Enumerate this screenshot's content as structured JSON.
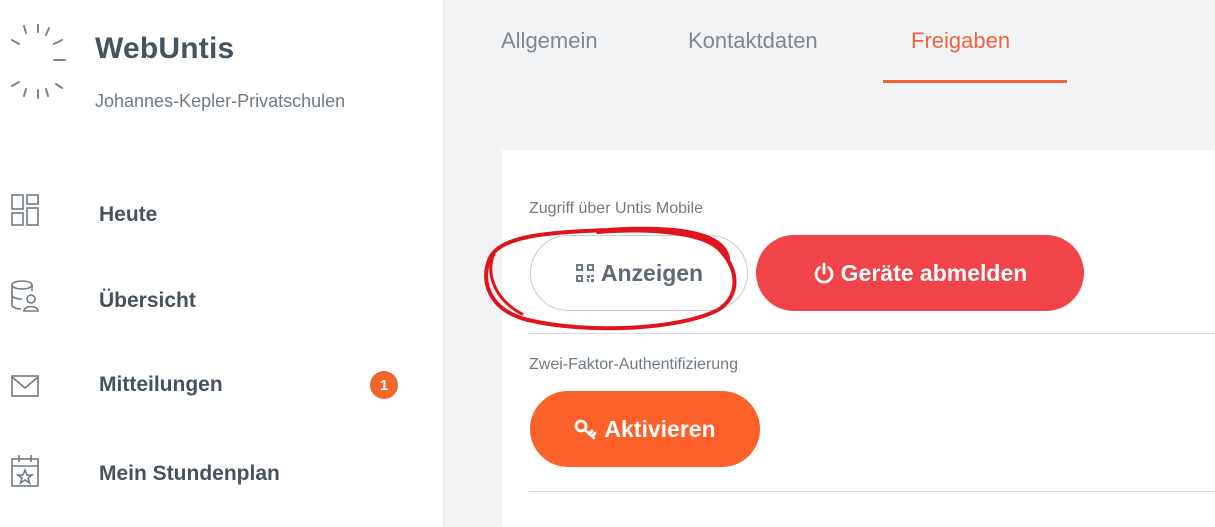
{
  "app": {
    "title": "WebUntis",
    "school": "Johannes-Kepler-Privatschulen"
  },
  "sidebar": {
    "items": [
      {
        "label": "Heute",
        "icon": "dashboard-icon"
      },
      {
        "label": "Übersicht",
        "icon": "database-user-icon"
      },
      {
        "label": "Mitteilungen",
        "icon": "mail-icon",
        "badge": "1"
      },
      {
        "label": "Mein Stundenplan",
        "icon": "calendar-star-icon"
      }
    ]
  },
  "tabs": [
    {
      "label": "Allgemein",
      "active": false
    },
    {
      "label": "Kontaktdaten",
      "active": false
    },
    {
      "label": "Freigaben",
      "active": true
    }
  ],
  "sections": {
    "mobile": {
      "label": "Zugriff über Untis Mobile",
      "show_button": "Anzeigen",
      "logout_button": "Geräte abmelden"
    },
    "twofactor": {
      "label": "Zwei-Faktor-Authentifizierung",
      "activate_button": "Aktivieren"
    }
  },
  "colors": {
    "accent": "#f0643c",
    "danger": "#f0434a",
    "primary_orange": "#fb6128",
    "badge": "#f2662e",
    "annotation": "#e0151b"
  }
}
